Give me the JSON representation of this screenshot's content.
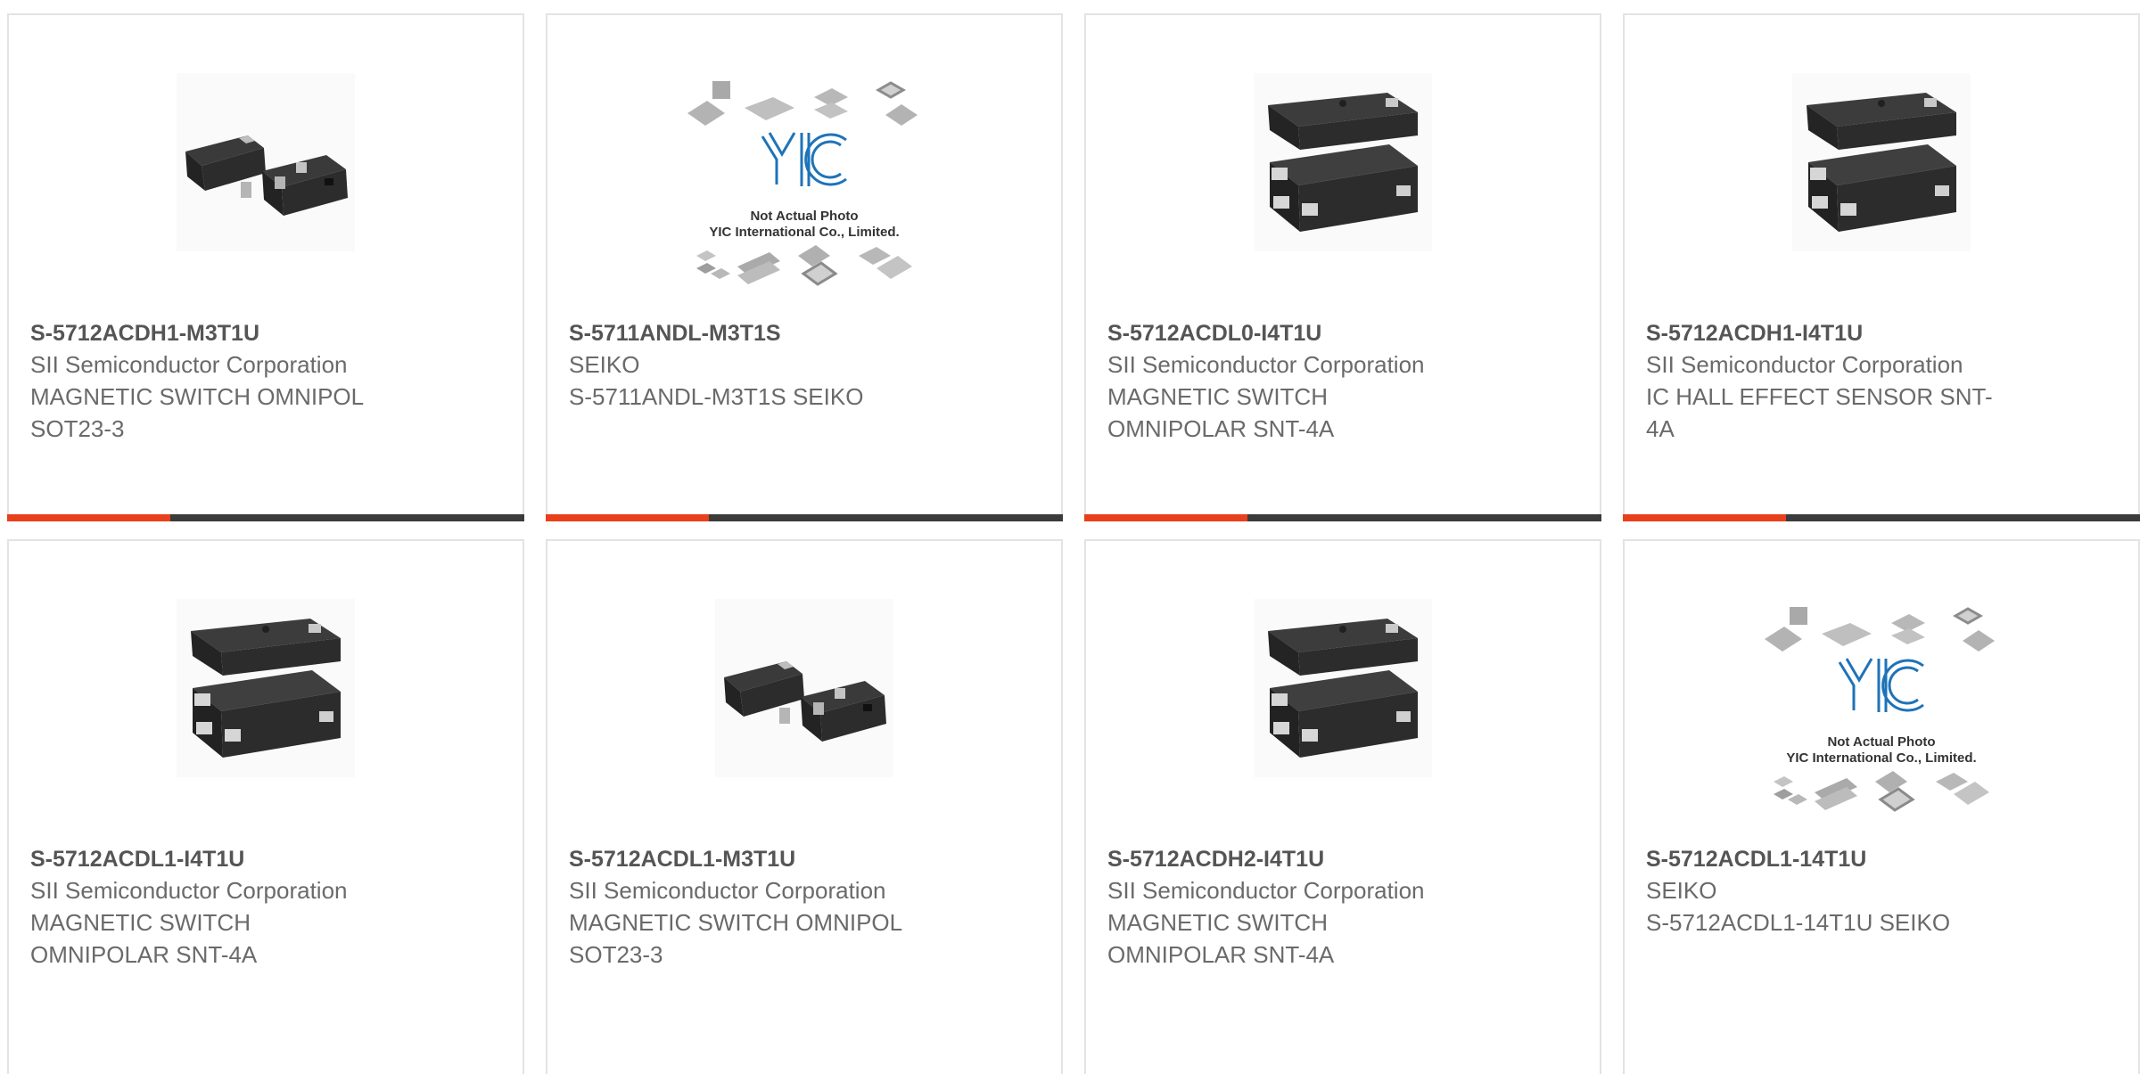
{
  "colors": {
    "accent": "#e8401c",
    "bar": "#3b3b3b",
    "chip": "#2c2c2c",
    "logo": "#1e73b8"
  },
  "products": [
    {
      "part": "S-5712ACDH1-M3T1U",
      "mfr": "SII Semiconductor Corporation",
      "desc_lines": [
        "MAGNETIC SWITCH OMNIPOL",
        "SOT23-3"
      ],
      "image": "sot23-3-chip",
      "show_bar": true
    },
    {
      "part": "S-5711ANDL-M3T1S",
      "mfr": "SEIKO",
      "desc_lines": [
        "S-5711ANDL-M3T1S SEIKO"
      ],
      "image": "yic-placeholder",
      "show_bar": true
    },
    {
      "part": "S-5712ACDL0-I4T1U",
      "mfr": "SII Semiconductor Corporation",
      "desc_lines": [
        "MAGNETIC SWITCH",
        "OMNIPOLAR SNT-4A"
      ],
      "image": "snt-4a-chip",
      "show_bar": true
    },
    {
      "part": "S-5712ACDH1-I4T1U",
      "mfr": "SII Semiconductor Corporation",
      "desc_lines": [
        "IC HALL EFFECT SENSOR SNT-",
        "4A"
      ],
      "image": "snt-4a-chip",
      "show_bar": true
    },
    {
      "part": "S-5712ACDL1-I4T1U",
      "mfr": "SII Semiconductor Corporation",
      "desc_lines": [
        "MAGNETIC SWITCH",
        "OMNIPOLAR SNT-4A"
      ],
      "image": "snt-4a-chip",
      "show_bar": false
    },
    {
      "part": "S-5712ACDL1-M3T1U",
      "mfr": "SII Semiconductor Corporation",
      "desc_lines": [
        "MAGNETIC SWITCH OMNIPOL",
        "SOT23-3"
      ],
      "image": "sot23-3-chip",
      "show_bar": false
    },
    {
      "part": "S-5712ACDH2-I4T1U",
      "mfr": "SII Semiconductor Corporation",
      "desc_lines": [
        "MAGNETIC SWITCH",
        "OMNIPOLAR SNT-4A"
      ],
      "image": "snt-4a-chip",
      "show_bar": false
    },
    {
      "part": "S-5712ACDL1-14T1U",
      "mfr": "SEIKO",
      "desc_lines": [
        "S-5712ACDL1-14T1U SEIKO"
      ],
      "image": "yic-placeholder",
      "show_bar": false
    }
  ],
  "placeholder": {
    "logo_text": "YIC",
    "line1": "Not Actual Photo",
    "line2": "YIC International Co., Limited."
  }
}
